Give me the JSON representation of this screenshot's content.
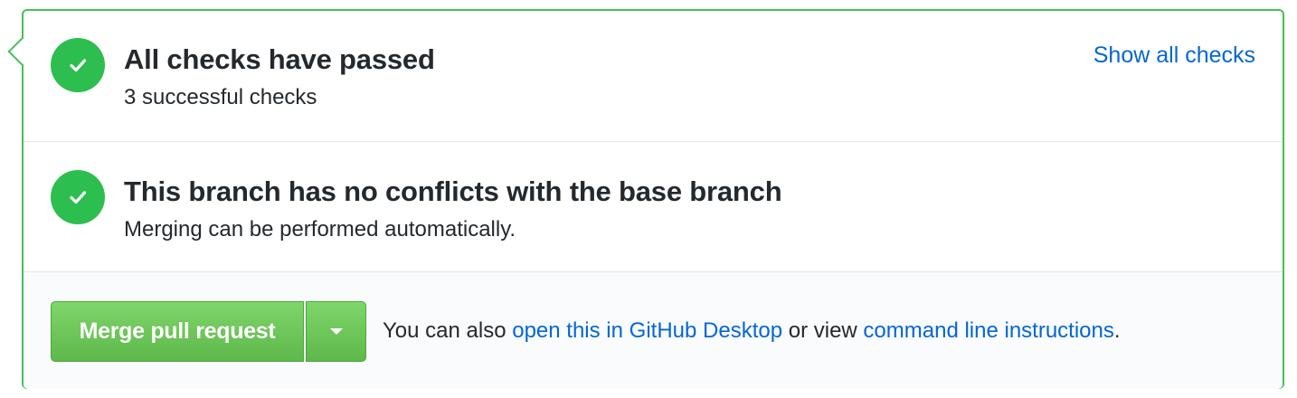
{
  "checks": {
    "title": "All checks have passed",
    "subtitle": "3 successful checks",
    "show_all_label": "Show all checks",
    "icon": "check-icon"
  },
  "conflicts": {
    "title": "This branch has no conflicts with the base branch",
    "subtitle": "Merging can be performed automatically.",
    "icon": "check-icon"
  },
  "actions": {
    "merge_label": "Merge pull request",
    "dropdown_icon": "caret-down-icon",
    "help_prefix": "You can also ",
    "desktop_link": "open this in GitHub Desktop",
    "help_middle": " or view ",
    "cli_link": "command line instructions",
    "help_suffix": "."
  },
  "colors": {
    "success": "#2cbe4e",
    "border": "#45c05a",
    "link": "#0366d6",
    "button": "#6cc644",
    "text": "#24292e"
  }
}
